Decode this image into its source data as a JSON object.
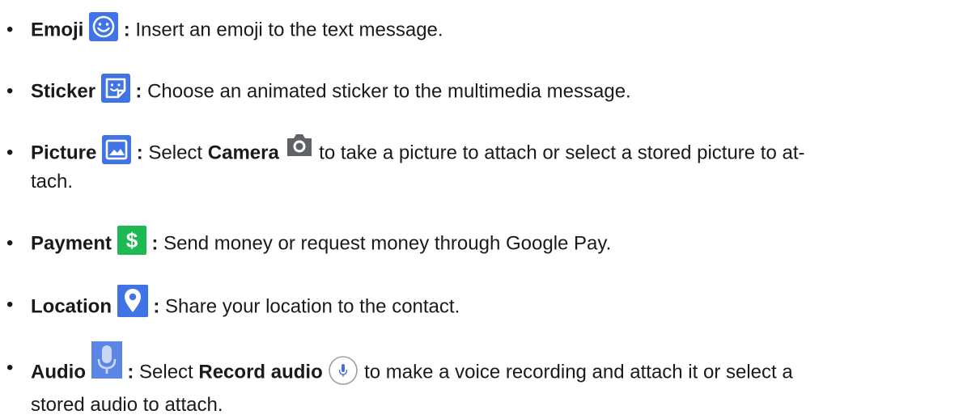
{
  "bullet": "•",
  "colon": ":",
  "items": [
    {
      "label": "Emoji",
      "description": "Insert an emoji to the text message.",
      "icon": "emoji-icon"
    },
    {
      "label": "Sticker",
      "description": "Choose an animated sticker to the multimedia message.",
      "icon": "sticker-icon"
    },
    {
      "label": "Picture",
      "description_before": "Select",
      "inline_label": "Camera",
      "description_after_line1": "to take a picture to attach or select a stored picture to at-",
      "description_after_line2": "tach.",
      "icon": "picture-icon",
      "inline_icon": "camera-icon"
    },
    {
      "label": "Payment",
      "description": "Send money or request money through Google Pay.",
      "icon": "payment-icon"
    },
    {
      "label": "Location",
      "description": "Share your location to the contact.",
      "icon": "location-icon"
    },
    {
      "label": "Audio",
      "description_before": "Select",
      "inline_label": "Record audio",
      "description_after_line1": "to make a voice recording and attach it or select a",
      "description_after_line2": "stored audio to attach.",
      "icon": "microphone-icon",
      "inline_icon": "record-audio-icon"
    }
  ],
  "colors": {
    "emoji": "#3f73e6",
    "sticker": "#3f73e6",
    "picture": "#3f73e6",
    "camera": "#5f6368",
    "payment": "#1db954",
    "location": "#3f73e6",
    "audio": "#5b86e5",
    "record": "#4a6fd6"
  }
}
